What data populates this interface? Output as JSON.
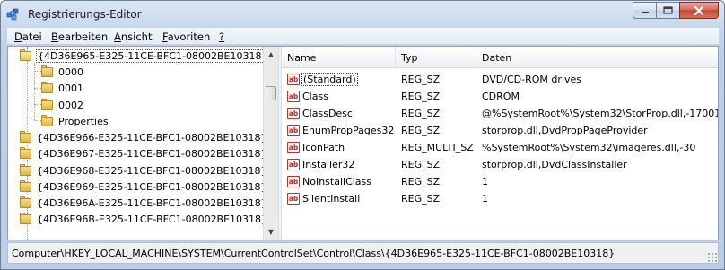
{
  "window": {
    "title": "Registrierungs-Editor",
    "icon": "registry-editor-icon",
    "accent_close_color": "#c44a33"
  },
  "menu": {
    "items": [
      {
        "mnemonic": "D",
        "rest": "atei"
      },
      {
        "mnemonic": "B",
        "rest": "earbeiten"
      },
      {
        "mnemonic": "A",
        "rest": "nsicht"
      },
      {
        "mnemonic": "F",
        "rest": "avoriten"
      },
      {
        "mnemonic": "?",
        "rest": ""
      }
    ]
  },
  "tree": {
    "selected_key": "{4D36E965-E325-11CE-BFC1-08002BE10318}",
    "children": [
      "0000",
      "0001",
      "0002",
      "Properties"
    ],
    "siblings": [
      "{4D36E966-E325-11CE-BFC1-08002BE10318}",
      "{4D36E967-E325-11CE-BFC1-08002BE10318}",
      "{4D36E968-E325-11CE-BFC1-08002BE10318}",
      "{4D36E969-E325-11CE-BFC1-08002BE10318}",
      "{4D36E96A-E325-11CE-BFC1-08002BE10318}",
      "{4D36E96B-E325-11CE-BFC1-08002BE10318}"
    ]
  },
  "list": {
    "headers": {
      "name": "Name",
      "type": "Typ",
      "data": "Daten"
    },
    "rows": [
      {
        "icon": "string-value-icon",
        "name": "(Standard)",
        "type": "REG_SZ",
        "data": "DVD/CD-ROM drives"
      },
      {
        "icon": "string-value-icon",
        "name": "Class",
        "type": "REG_SZ",
        "data": "CDROM"
      },
      {
        "icon": "string-value-icon",
        "name": "ClassDesc",
        "type": "REG_SZ",
        "data": "@%SystemRoot%\\System32\\StorProp.dll,-17001"
      },
      {
        "icon": "string-value-icon",
        "name": "EnumPropPages32",
        "type": "REG_SZ",
        "data": "storprop.dll,DvdPropPageProvider"
      },
      {
        "icon": "string-value-icon",
        "name": "IconPath",
        "type": "REG_MULTI_SZ",
        "data": "%SystemRoot%\\System32\\imageres.dll,-30"
      },
      {
        "icon": "string-value-icon",
        "name": "Installer32",
        "type": "REG_SZ",
        "data": "storprop.dll,DvdClassInstaller"
      },
      {
        "icon": "string-value-icon",
        "name": "NoInstallClass",
        "type": "REG_SZ",
        "data": "1"
      },
      {
        "icon": "string-value-icon",
        "name": "SilentInstall",
        "type": "REG_SZ",
        "data": "1"
      }
    ],
    "value_icon_text": "ab"
  },
  "status": {
    "path": "Computer\\HKEY_LOCAL_MACHINE\\SYSTEM\\CurrentControlSet\\Control\\Class\\{4D36E965-E325-11CE-BFC1-08002BE10318}"
  }
}
